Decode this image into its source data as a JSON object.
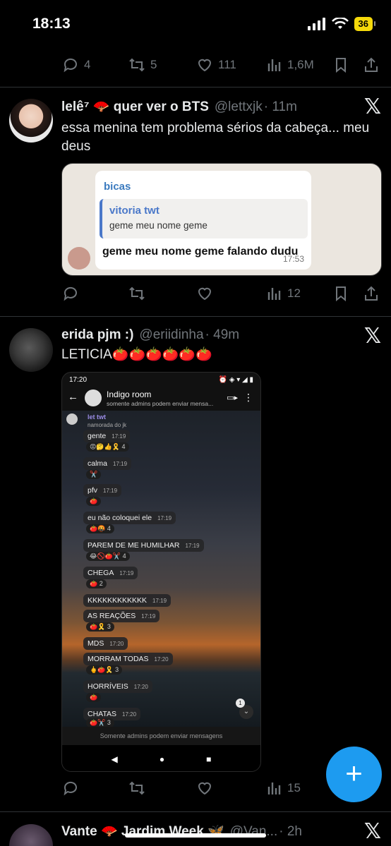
{
  "status_bar": {
    "time": "18:13",
    "battery": "36"
  },
  "tweet0_actions": {
    "replies": "4",
    "retweets": "5",
    "likes": "111",
    "views": "1,6M"
  },
  "tweet1": {
    "name": "lelê⁷ 🪭 quer ver o BTS",
    "handle": "@lettxjk",
    "time": "· 11m",
    "text": "essa menina tem problema sérios da cabeça... meu deus",
    "quote": {
      "sender": "bicas",
      "quoted_author": "vitoria twt",
      "quoted_text": "geme meu nome geme",
      "message": "geme meu nome geme falando dudu",
      "time": "17:53"
    },
    "actions": {
      "replies": "",
      "retweets": "",
      "likes": "",
      "views": "12"
    }
  },
  "tweet2": {
    "name": "erida pjm :)",
    "handle": "@eriidinha",
    "time": "· 49m",
    "text": "LETICIA🍅🍅🍅🍅🍅🍅",
    "screenshot": {
      "status_time": "17:20",
      "group_name": "Indigo room",
      "group_sub": "somente admins podem enviar mensa...",
      "sender": "let twt",
      "sender_tag": "namorada do jk",
      "messages": [
        {
          "text": "gente",
          "time": "17:19",
          "reactions": "😡🤔👍🎗️ 4"
        },
        {
          "text": "calma",
          "time": "17:19",
          "reactions": "✂️"
        },
        {
          "text": "pfv",
          "time": "17:19",
          "reactions": "🍅"
        },
        {
          "text": "eu não coloquei ele",
          "time": "17:19",
          "reactions": "🍅🤬 4"
        },
        {
          "text": "PAREM DE ME HUMILHAR",
          "time": "17:19",
          "reactions": "😂🚫🍅✂️ 4"
        },
        {
          "text": "CHEGA",
          "time": "17:19",
          "reactions": "🍅 2"
        },
        {
          "text": "KKKKKKKKKKKK",
          "time": "17:19",
          "reactions": ""
        },
        {
          "text": "AS REAÇÕES",
          "time": "17:19",
          "reactions": "🍅🎗️ 3"
        },
        {
          "text": "MDS",
          "time": "17:20",
          "reactions": ""
        },
        {
          "text": "MORRAM TODAS",
          "time": "17:20",
          "reactions": "🖕🍅🎗️ 3"
        },
        {
          "text": "HORRÍVEIS",
          "time": "17:20",
          "reactions": "🍅"
        },
        {
          "text": "CHATAS",
          "time": "17:20",
          "reactions": "🍅✂️ 3"
        }
      ],
      "unread_badge": "1",
      "footer": "Somente admins podem enviar mensagens"
    },
    "actions": {
      "replies": "",
      "retweets": "",
      "likes": "",
      "views": "15"
    }
  },
  "tweet3": {
    "name": "Vante 🪭 Jardim Week 🦋",
    "handle": "@Van...",
    "time": "· 2h"
  },
  "fab_label": "+"
}
